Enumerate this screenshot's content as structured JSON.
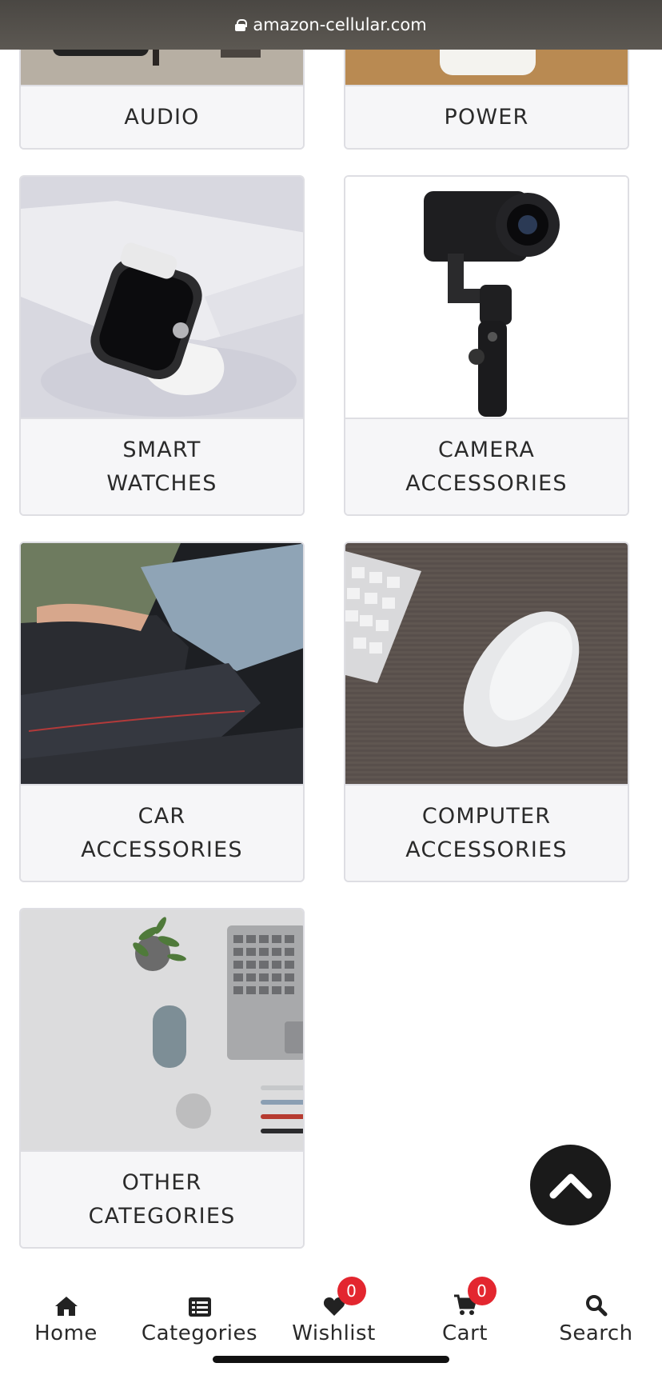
{
  "browser": {
    "url": "amazon-cellular.com"
  },
  "categories": [
    {
      "label": "AUDIO"
    },
    {
      "label": "POWER"
    },
    {
      "label": "SMART\nWATCHES"
    },
    {
      "label": "CAMERA\nACCESSORIES"
    },
    {
      "label": "CAR\nACCESSORIES"
    },
    {
      "label": "COMPUTER\nACCESSORIES"
    },
    {
      "label": "OTHER\nCATEGORIES"
    }
  ],
  "bottom_nav": {
    "home": {
      "label": "Home",
      "icon": "home-icon"
    },
    "categories": {
      "label": "Categories",
      "icon": "list-icon"
    },
    "wishlist": {
      "label": "Wishlist",
      "icon": "heart-icon",
      "count": "0"
    },
    "cart": {
      "label": "Cart",
      "icon": "cart-icon",
      "count": "0"
    },
    "search": {
      "label": "Search",
      "icon": "search-icon"
    }
  },
  "colors": {
    "badge": "#e3262f",
    "scroll_button": "#1a1a1a",
    "card_bg": "#f6f6f8"
  }
}
